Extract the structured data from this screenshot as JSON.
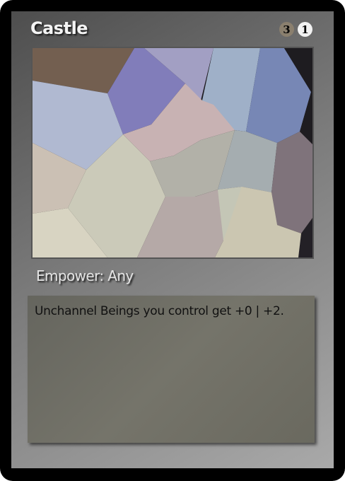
{
  "card": {
    "name": "Castle",
    "cost": [
      {
        "value": "3",
        "kind": "generic",
        "color": "#8a7f6e"
      },
      {
        "value": "1",
        "kind": "white",
        "color": "#f2f2f2"
      }
    ],
    "art_icon": "abstract-voronoi-art",
    "type_line": "Empower: Any",
    "rules_text": "Unchannel Beings you control get +0 | +2."
  }
}
